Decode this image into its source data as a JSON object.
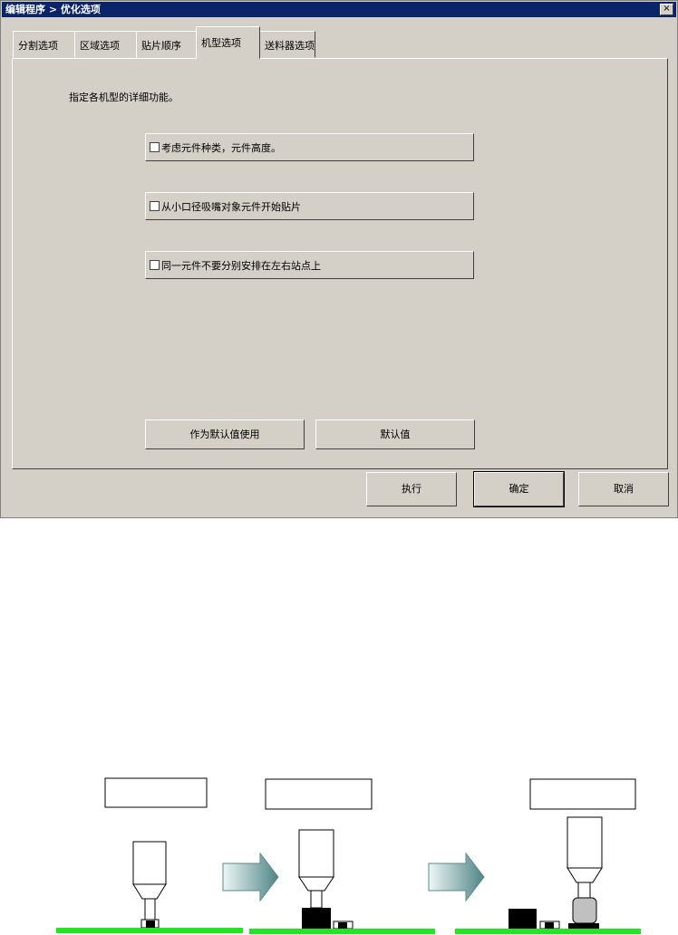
{
  "window": {
    "title": "编辑程序 > 优化选项",
    "close_glyph": "×"
  },
  "tabs": [
    {
      "label": "分割选项"
    },
    {
      "label": "区域选项"
    },
    {
      "label": "贴片顺序"
    },
    {
      "label": "机型选项"
    },
    {
      "label": "送料器选项"
    }
  ],
  "panel": {
    "description": "指定各机型的详细功能。",
    "options": [
      {
        "label": "考虑元件种类，元件高度。",
        "checked": false
      },
      {
        "label": "从小口径吸嘴对象元件开始贴片",
        "checked": false
      },
      {
        "label": "同一元件不要分别安排在左右站点上",
        "checked": false
      }
    ],
    "set_default_label": "作为默认值使用",
    "default_label": "默认值"
  },
  "footer": {
    "execute_label": "执行",
    "ok_label": "确定",
    "cancel_label": "取消"
  },
  "colors": {
    "title_bar": "#0a246a",
    "dialog_bg": "#d4d0c8",
    "pcb_green": "#22e622",
    "arrow_teal": "#6e9e9e"
  }
}
